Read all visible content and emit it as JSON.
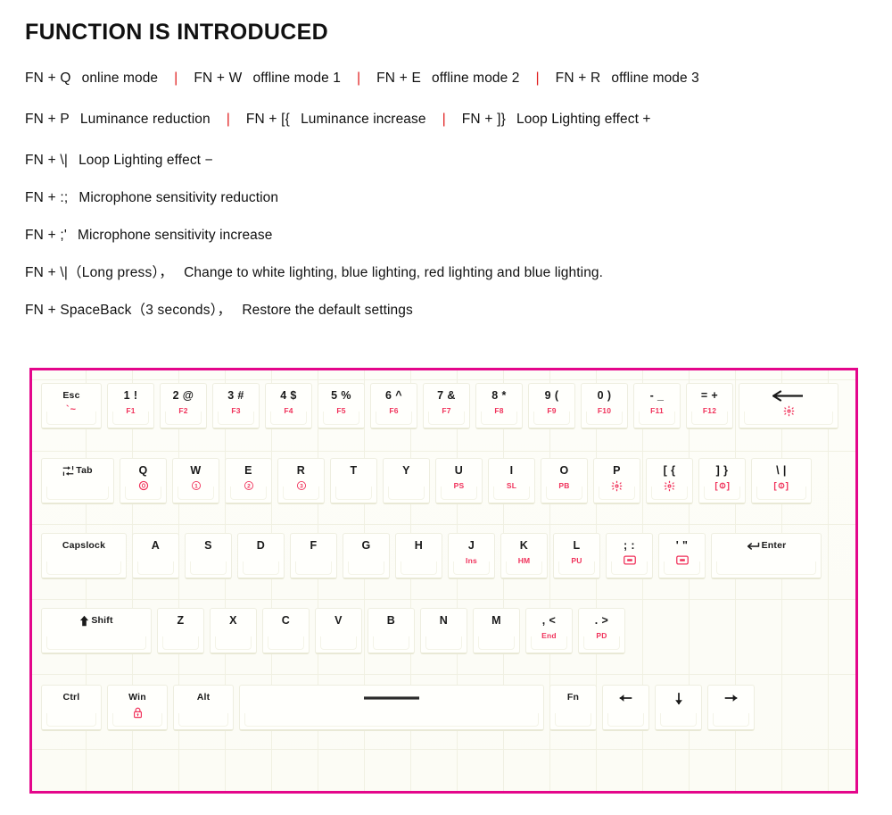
{
  "page_title": "FUNCTION IS INTRODUCED",
  "colors": {
    "frame_border": "#e4068b",
    "separator_red": "#e02020",
    "legend_red": "#f0325b",
    "text_black": "#111111"
  },
  "function_lines": [
    {
      "segments": [
        {
          "combo": "FN + Q",
          "desc": "online mode"
        },
        {
          "combo": "FN + W",
          "desc": "offline mode 1"
        },
        {
          "combo": "FN + E",
          "desc": "offline mode 2"
        },
        {
          "combo": "FN + R",
          "desc": "offline mode 3"
        }
      ]
    },
    {
      "segments": [
        {
          "combo": "FN + P",
          "desc": "Luminance reduction"
        },
        {
          "combo": "FN +  [{",
          "desc": "Luminance increase"
        },
        {
          "combo": "FN +  ]}",
          "desc": "Loop Lighting effect +"
        }
      ]
    },
    {
      "segments": [
        {
          "combo": "FN + \\|",
          "desc": "Loop Lighting effect −"
        }
      ]
    },
    {
      "segments": [
        {
          "combo": "FN + :;",
          "desc": "Microphone sensitivity reduction"
        }
      ]
    },
    {
      "segments": [
        {
          "combo": "FN + ;'",
          "desc": "Microphone sensitivity increase"
        }
      ]
    },
    {
      "segments": [
        {
          "combo": "FN + \\|（Long press），",
          "desc": "Change to white lighting, blue lighting, red lighting and blue lighting."
        }
      ]
    },
    {
      "segments": [
        {
          "combo": "FN + SpaceBack（3 seconds），",
          "desc": "Restore the default settings"
        }
      ]
    }
  ],
  "keyboard": {
    "rows": [
      {
        "name": "number-row",
        "keys": [
          {
            "main": "Esc",
            "sub": "`~",
            "sub_type": "esc-tilde",
            "width": "w125",
            "small": true
          },
          {
            "main": "1 !",
            "sub": "F1",
            "width": "w1"
          },
          {
            "main": "2 @",
            "sub": "F2",
            "width": "w1"
          },
          {
            "main": "3 #",
            "sub": "F3",
            "width": "w1"
          },
          {
            "main": "4 $",
            "sub": "F4",
            "width": "w1"
          },
          {
            "main": "5 %",
            "sub": "F5",
            "width": "w1"
          },
          {
            "main": "6 ^",
            "sub": "F6",
            "width": "w1"
          },
          {
            "main": "7 &",
            "sub": "F7",
            "width": "w1"
          },
          {
            "main": "8 *",
            "sub": "F8",
            "width": "w1"
          },
          {
            "main": "9 (",
            "sub": "F9",
            "width": "w1"
          },
          {
            "main": "0 )",
            "sub": "F10",
            "width": "w1"
          },
          {
            "main": "- _",
            "sub": "F11",
            "width": "w1"
          },
          {
            "main": "= +",
            "sub": "F12",
            "width": "w1"
          },
          {
            "main": "",
            "icon": "backspace-arrow-icon",
            "sub_icon": "gear-icon",
            "width": "wbk"
          }
        ]
      },
      {
        "name": "qwerty-row",
        "keys": [
          {
            "main": "Tab",
            "icon": "tab-icon",
            "width": "w15",
            "small": true
          },
          {
            "main": "Q",
            "sub_icon": "circle-zero-icon",
            "width": "w1"
          },
          {
            "main": "W",
            "sub_icon": "circle-one-icon",
            "width": "w1"
          },
          {
            "main": "E",
            "sub_icon": "circle-two-icon",
            "width": "w1"
          },
          {
            "main": "R",
            "sub_icon": "circle-three-icon",
            "width": "w1"
          },
          {
            "main": "T",
            "width": "w1"
          },
          {
            "main": "Y",
            "width": "w1"
          },
          {
            "main": "U",
            "sub": "PS",
            "width": "w1"
          },
          {
            "main": "I",
            "sub": "SL",
            "width": "w1"
          },
          {
            "main": "O",
            "sub": "PB",
            "width": "w1"
          },
          {
            "main": "P",
            "sub_icon": "gear-icon",
            "width": "w1"
          },
          {
            "main": "[ {",
            "sub_icon": "gear-icon",
            "width": "w1"
          },
          {
            "main": "] }",
            "sub_icon": "bracket-light-icon",
            "width": "w1"
          },
          {
            "main": "\\ |",
            "sub_icon": "bracket-light-icon",
            "width": "w125"
          }
        ]
      },
      {
        "name": "home-row",
        "keys": [
          {
            "main": "Capslock",
            "width": "w175",
            "small": true
          },
          {
            "main": "A",
            "width": "w1"
          },
          {
            "main": "S",
            "width": "w1"
          },
          {
            "main": "D",
            "width": "w1"
          },
          {
            "main": "F",
            "width": "w1"
          },
          {
            "main": "G",
            "width": "w1"
          },
          {
            "main": "H",
            "width": "w1"
          },
          {
            "main": "J",
            "sub": "Ins",
            "width": "w1"
          },
          {
            "main": "K",
            "sub": "HM",
            "width": "w1"
          },
          {
            "main": "L",
            "sub": "PU",
            "width": "w1"
          },
          {
            "main": "; :",
            "sub_icon": "mic-icon",
            "width": "w1"
          },
          {
            "main": "' \"",
            "sub_icon": "mic-icon",
            "width": "w1"
          },
          {
            "main": "Enter",
            "icon": "enter-arrow-icon",
            "width": "wenter",
            "small": true
          }
        ]
      },
      {
        "name": "shift-row",
        "keys": [
          {
            "main": "Shift",
            "icon": "shift-arrow-icon",
            "width": "w225",
            "small": true
          },
          {
            "main": "Z",
            "width": "w1"
          },
          {
            "main": "X",
            "width": "w1"
          },
          {
            "main": "C",
            "width": "w1"
          },
          {
            "main": "V",
            "width": "w1"
          },
          {
            "main": "B",
            "width": "w1"
          },
          {
            "main": "N",
            "width": "w1"
          },
          {
            "main": "M",
            "width": "w1"
          },
          {
            "main": ", <",
            "sub": "End",
            "width": "w1"
          },
          {
            "main": ". >",
            "sub": "PD",
            "width": "w1"
          }
        ]
      },
      {
        "name": "bottom-row",
        "keys": [
          {
            "main": "Ctrl",
            "width": "w125",
            "small": true
          },
          {
            "main": "Win",
            "sub_icon": "lock-icon",
            "width": "w125",
            "small": true
          },
          {
            "main": "Alt",
            "width": "w125",
            "small": true
          },
          {
            "main": "",
            "icon": "spacebar-dash-icon",
            "width": "wspace"
          },
          {
            "main": "Fn",
            "width": "w1",
            "small": true
          },
          {
            "main": "",
            "icon": "arrow-left-icon",
            "width": "w1"
          },
          {
            "main": "",
            "icon": "arrow-down-icon",
            "width": "w1"
          },
          {
            "main": "",
            "icon": "arrow-right-icon",
            "width": "w1"
          }
        ]
      }
    ]
  }
}
